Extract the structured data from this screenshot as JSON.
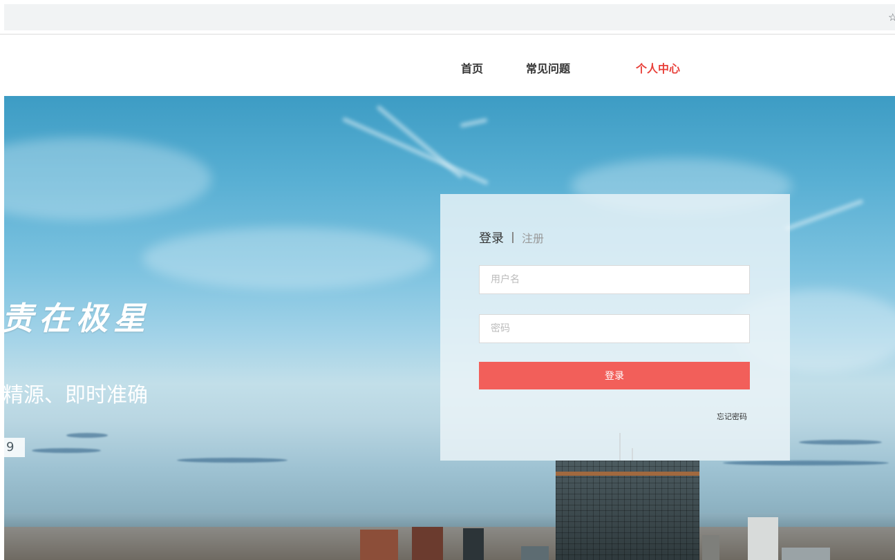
{
  "browser": {
    "star_icon": "star-icon",
    "star_glyph": "☆"
  },
  "nav": {
    "items": [
      {
        "label": "首页",
        "active": false
      },
      {
        "label": "常见问题",
        "active": false
      },
      {
        "label": "个人中心",
        "active": true
      }
    ],
    "active_color": "#e8403a"
  },
  "hero": {
    "slogan": "责在极星",
    "subtitle": "精源、即时准确",
    "year_fragment": "9"
  },
  "login": {
    "tab_login": "登录",
    "tab_register": "注册",
    "username_placeholder": "用户名",
    "password_placeholder": "密码",
    "submit_label": "登录",
    "forgot_label": "忘记密码",
    "button_color": "#f25f5a"
  }
}
